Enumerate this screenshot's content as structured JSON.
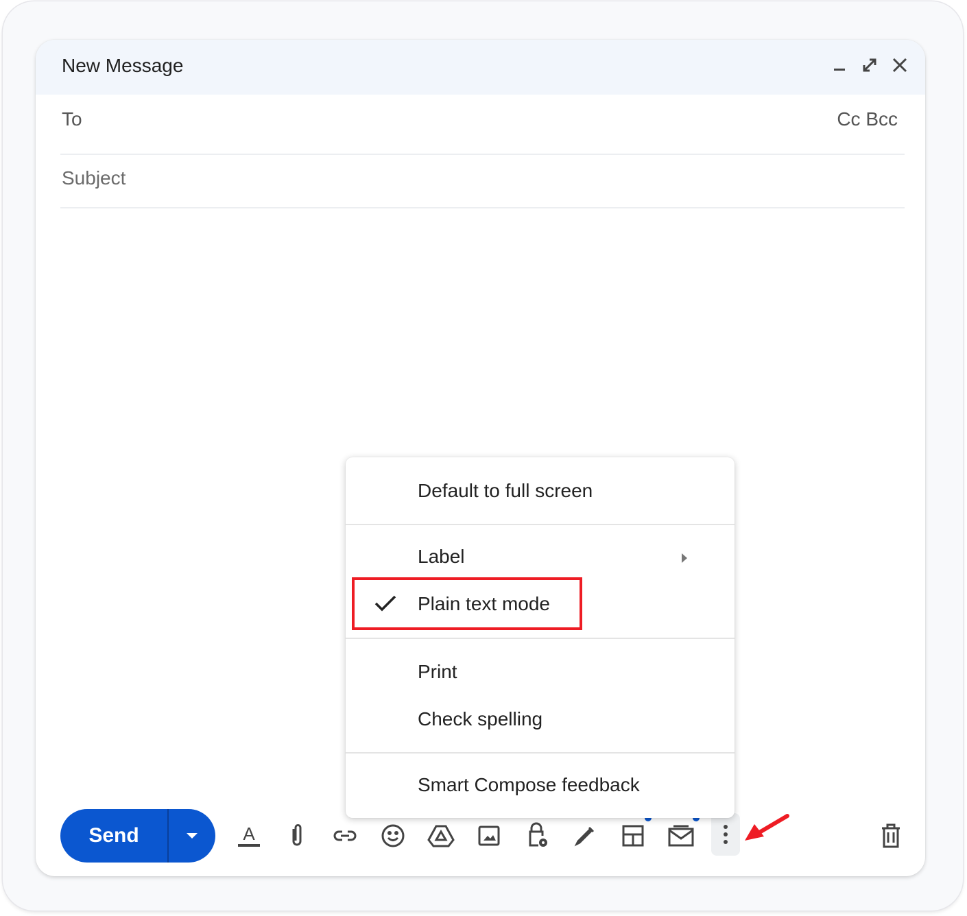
{
  "compose": {
    "title": "New Message",
    "to_label": "To",
    "cc_bcc": "Cc Bcc",
    "subject_placeholder": "Subject"
  },
  "toolbar": {
    "send_label": "Send"
  },
  "menu": {
    "items": [
      {
        "label": "Default to full screen"
      },
      {
        "label": "Label"
      },
      {
        "label": "Plain text mode",
        "checked": true
      },
      {
        "label": "Print"
      },
      {
        "label": "Check spelling"
      },
      {
        "label": "Smart Compose feedback"
      }
    ]
  },
  "colors": {
    "send": "#0b57d0",
    "highlight": "#ee1c24",
    "arrow": "#ee1c24"
  }
}
